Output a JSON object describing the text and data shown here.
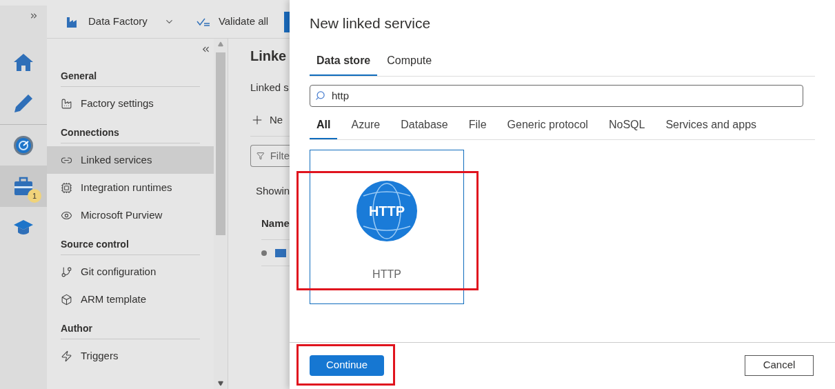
{
  "top_bar": {
    "factory": "Data Factory",
    "validate": "Validate all"
  },
  "rail": [
    {
      "kind": "home",
      "selected": false
    },
    {
      "kind": "author",
      "selected": false
    },
    {
      "kind": "monitor",
      "selected": false
    },
    {
      "kind": "manage",
      "selected": true,
      "badge": "1"
    },
    {
      "kind": "learn",
      "selected": false
    }
  ],
  "sidebar": {
    "sections": [
      {
        "title": "General",
        "items": [
          {
            "kind": "factory",
            "label": "Factory settings",
            "selected": false
          }
        ]
      },
      {
        "title": "Connections",
        "items": [
          {
            "kind": "linked",
            "label": "Linked services",
            "selected": true
          },
          {
            "kind": "runtime",
            "label": "Integration runtimes",
            "selected": false
          },
          {
            "kind": "purview",
            "label": "Microsoft Purview",
            "selected": false
          }
        ]
      },
      {
        "title": "Source control",
        "items": [
          {
            "kind": "git",
            "label": "Git configuration",
            "selected": false
          },
          {
            "kind": "arm",
            "label": "ARM template",
            "selected": false
          }
        ]
      },
      {
        "title": "Author",
        "items": [
          {
            "kind": "trigger",
            "label": "Triggers",
            "selected": false
          }
        ]
      }
    ]
  },
  "main": {
    "title": "Linke",
    "subtitle": "Linked s",
    "new_button": "Ne",
    "filter_placeholder": "Filte",
    "showing": "Showin",
    "column_1": "Name"
  },
  "dialog": {
    "title": "New linked service",
    "tabs": [
      {
        "label": "Data store",
        "selected": true
      },
      {
        "label": "Compute",
        "selected": false
      }
    ],
    "search": {
      "value": "http"
    },
    "categories": [
      {
        "label": "All",
        "selected": true
      },
      {
        "label": "Azure",
        "selected": false
      },
      {
        "label": "Database",
        "selected": false
      },
      {
        "label": "File",
        "selected": false
      },
      {
        "label": "Generic protocol",
        "selected": false
      },
      {
        "label": "NoSQL",
        "selected": false
      },
      {
        "label": "Services and apps",
        "selected": false
      }
    ],
    "connectors": [
      {
        "logo_text": "HTTP",
        "label": "HTTP",
        "selected": true,
        "highlighted": true
      }
    ],
    "continue": {
      "label": "Continue",
      "highlighted": true
    },
    "cancel": "Cancel"
  }
}
